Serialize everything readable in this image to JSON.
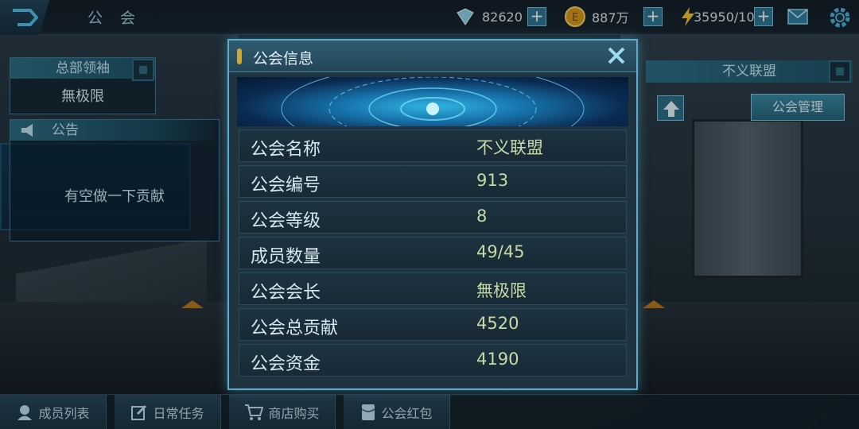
{
  "header": {
    "title": "公 会",
    "resources": [
      {
        "icon": "crystal-icon",
        "value": "82620"
      },
      {
        "icon": "gold-coin-icon",
        "value": "887万"
      },
      {
        "icon": "lightning-icon",
        "value": "35950/100"
      }
    ]
  },
  "left_panel": {
    "leader_label": "总部领袖",
    "leader_name": "無极限",
    "notice_label": "公告",
    "notice_text": "有空做一下贡献"
  },
  "right_panel": {
    "alliance_name": "不义联盟",
    "manage_label": "公会管理"
  },
  "modal": {
    "title": "公会信息",
    "rows": [
      {
        "label": "公会名称",
        "value": "不义联盟"
      },
      {
        "label": "公会编号",
        "value": "913"
      },
      {
        "label": "公会等级",
        "value": "8"
      },
      {
        "label": "成员数量",
        "value": "49/45"
      },
      {
        "label": "公会会长",
        "value": "無极限"
      },
      {
        "label": "公会总贡献",
        "value": "4520"
      },
      {
        "label": "公会资金",
        "value": "4190"
      }
    ]
  },
  "bottom_tabs": [
    {
      "label": "成员列表",
      "icon": "member-icon"
    },
    {
      "label": "日常任务",
      "icon": "edit-task-icon"
    },
    {
      "label": "商店购买",
      "icon": "cart-icon"
    },
    {
      "label": "公会红包",
      "icon": "red-packet-icon"
    }
  ],
  "colors": {
    "accent": "#5aaecb",
    "value_text": "#c7d9a6",
    "gold": "#c9a93a"
  }
}
